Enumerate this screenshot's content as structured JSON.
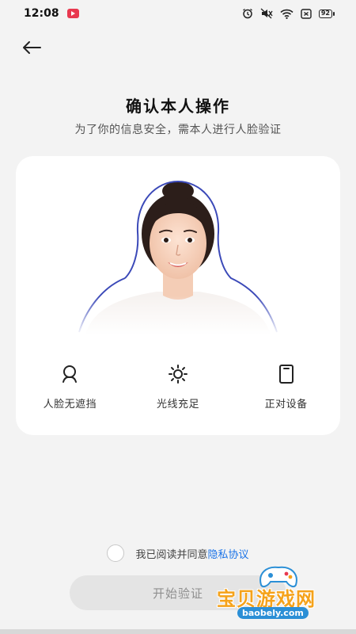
{
  "status_bar": {
    "time": "12:08",
    "battery": "92",
    "icons": [
      "alarm-icon",
      "mute-icon",
      "wifi-icon",
      "sim-icon",
      "battery-icon"
    ]
  },
  "header": {
    "title": "确认本人操作",
    "subtitle": "为了你的信息安全，需本人进行人脸验证"
  },
  "tips": [
    {
      "icon": "face-icon",
      "label": "人脸无遮挡"
    },
    {
      "icon": "sun-icon",
      "label": "光线充足"
    },
    {
      "icon": "phone-icon",
      "label": "正对设备"
    }
  ],
  "agreement": {
    "text": "我已阅读并同意",
    "link": "隐私协议"
  },
  "start_button": "开始验证",
  "watermark": {
    "title": "宝贝游戏网",
    "url": "baobely.com"
  },
  "colors": {
    "link": "#1a73e8",
    "button_bg": "#e4e4e4",
    "button_text": "#8f8f8f",
    "face_outline": "#3b49b8",
    "status_red": "#e8384f"
  }
}
